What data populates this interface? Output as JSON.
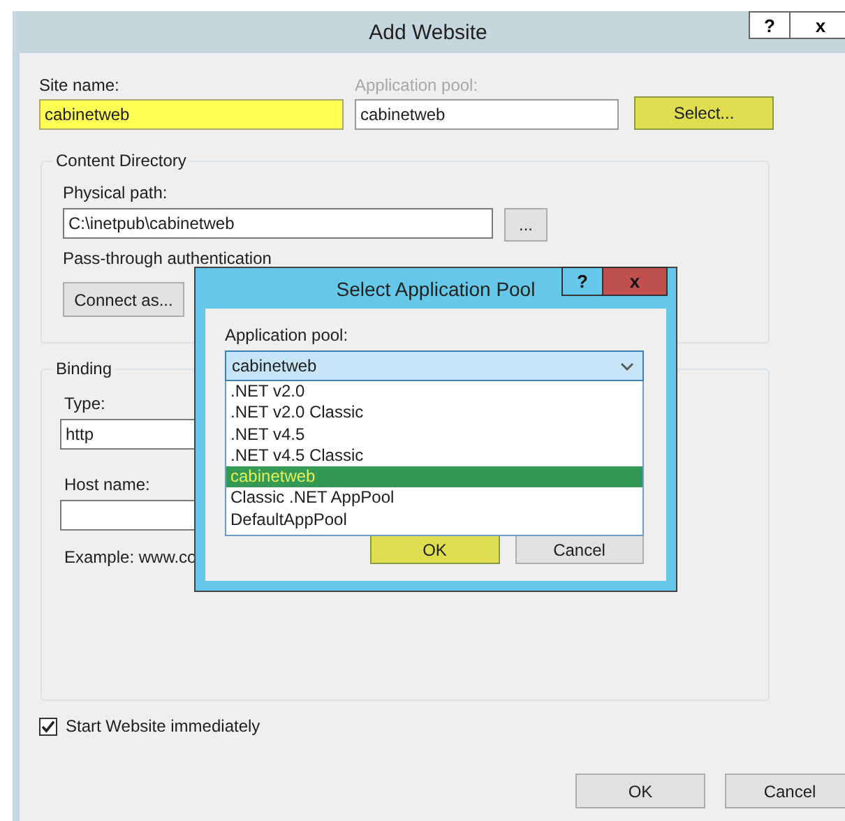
{
  "window": {
    "title": "Add Website",
    "help_button": "?",
    "close_button": "x"
  },
  "site_name": {
    "label": "Site name:",
    "value": "cabinetweb",
    "highlighted": true
  },
  "application_pool": {
    "label": "Application pool:",
    "value": "cabinetweb",
    "disabled": true
  },
  "select_button": {
    "label": "Select...",
    "highlighted": true
  },
  "content_directory": {
    "title": "Content Directory",
    "physical_path_label": "Physical path:",
    "physical_path": "C:\\inetpub\\cabinetweb",
    "browse_button": "...",
    "pass_through_label": "Pass-through authentication",
    "connect_button": "Connect as..."
  },
  "binding": {
    "title": "Binding",
    "type_label": "Type:",
    "type_value": "http",
    "host_label": "Host name:",
    "example": "Example: www.co"
  },
  "start_immediately": {
    "label": "Start Website immediately",
    "checked": true
  },
  "buttons": [
    {
      "label": "OK"
    },
    {
      "label": "Cancel"
    }
  ],
  "dialog": {
    "title": "Select Application Pool",
    "help_button": "?",
    "close_button": "x",
    "pool_label": "Application pool:",
    "combo_value": "cabinetweb",
    "items": [
      {
        "label": ".NET v2.0",
        "selected": false
      },
      {
        "label": ".NET v2.0 Classic",
        "selected": false
      },
      {
        "label": ".NET v4.5",
        "selected": false
      },
      {
        "label": ".NET v4.5 Classic",
        "selected": false
      },
      {
        "label": "cabinetweb",
        "selected": true
      },
      {
        "label": "Classic .NET AppPool",
        "selected": false
      },
      {
        "label": "DefaultAppPool",
        "selected": false
      }
    ],
    "buttons": [
      {
        "label": "OK",
        "highlighted": true
      },
      {
        "label": "Cancel",
        "highlighted": false
      }
    ]
  }
}
